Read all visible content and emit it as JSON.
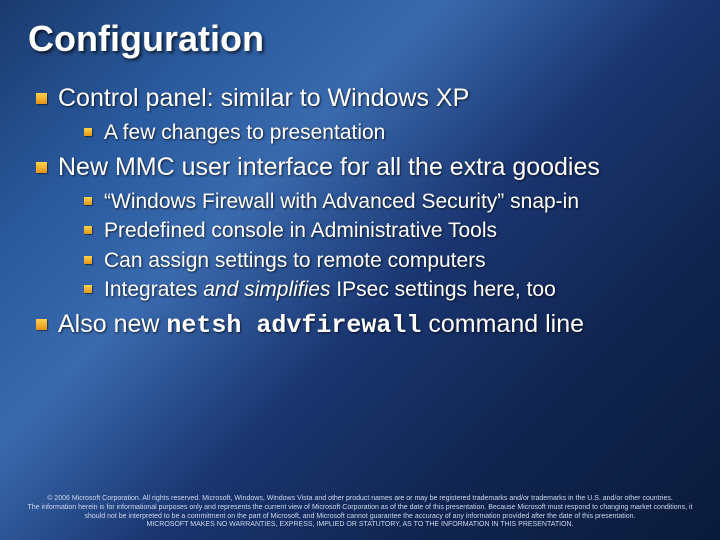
{
  "title": "Configuration",
  "bullets": {
    "b1": "Control panel: similar to Windows XP",
    "b1_1": "A few changes to presentation",
    "b2": "New MMC user interface for all the extra goodies",
    "b2_1": "“Windows Firewall with Advanced Security” snap-in",
    "b2_2": "Predefined console in Administrative Tools",
    "b2_3": "Can assign settings to remote computers",
    "b2_4_pre": "Integrates ",
    "b2_4_em": "and simplifies",
    "b2_4_post": " IPsec settings here, too",
    "b3_pre": "Also new ",
    "b3_code": "netsh advfirewall",
    "b3_post": " command line"
  },
  "footer": {
    "line1": "© 2006 Microsoft Corporation. All rights reserved. Microsoft, Windows, Windows Vista and other product names are or may be registered trademarks and/or trademarks in the U.S. and/or other countries.",
    "line2": "The information herein is for informational purposes only and represents the current view of Microsoft Corporation as of the date of this presentation. Because Microsoft must respond to changing market conditions, it should not be interpreted to be a commitment on the part of Microsoft, and Microsoft cannot guarantee the accuracy of any information provided after the date of this presentation.",
    "line3": "MICROSOFT MAKES NO WARRANTIES, EXPRESS, IMPLIED OR STATUTORY, AS TO THE INFORMATION IN THIS PRESENTATION."
  }
}
